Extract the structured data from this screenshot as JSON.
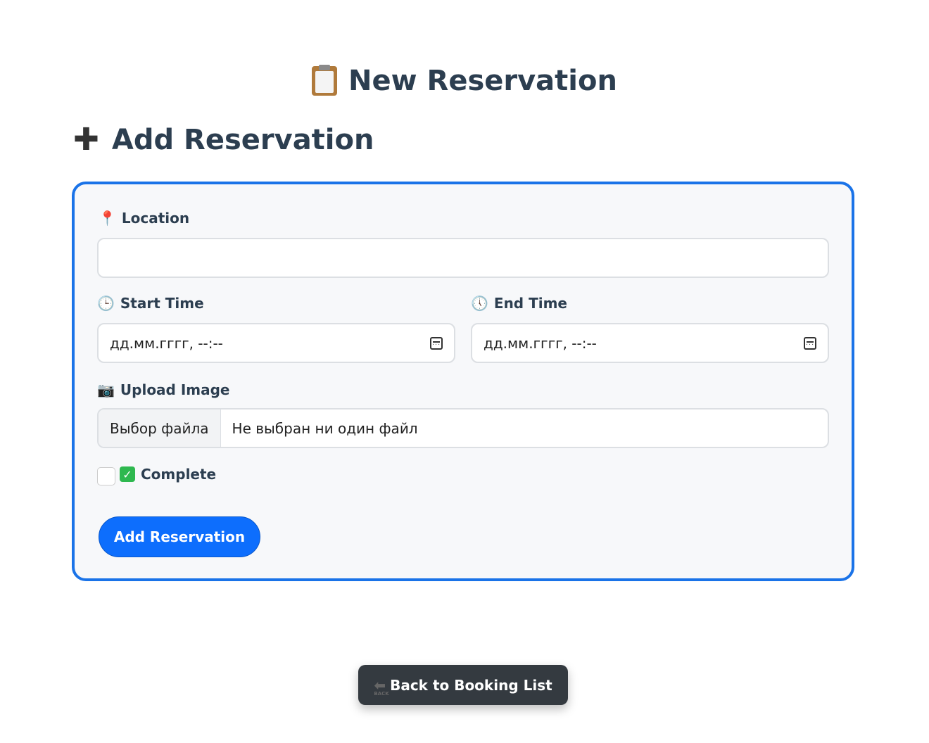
{
  "header": {
    "title": "New Reservation",
    "section_title": "Add Reservation"
  },
  "form": {
    "location": {
      "label": "Location",
      "value": ""
    },
    "start_time": {
      "label": "Start Time",
      "placeholder": "дд.мм.гггг, --:--"
    },
    "end_time": {
      "label": "End Time",
      "placeholder": "дд.мм.гггг, --:--"
    },
    "upload": {
      "label": "Upload Image",
      "button": "Выбор файла",
      "status": "Не выбран ни один файл"
    },
    "complete": {
      "label": "Complete",
      "checked": false
    },
    "submit_label": "Add Reservation"
  },
  "back_button": {
    "label": "Back to Booking List",
    "icon_text": "BACK"
  },
  "colors": {
    "accent": "#0d6efd",
    "card_border": "#1a73e8",
    "dark_button": "#343a40"
  }
}
